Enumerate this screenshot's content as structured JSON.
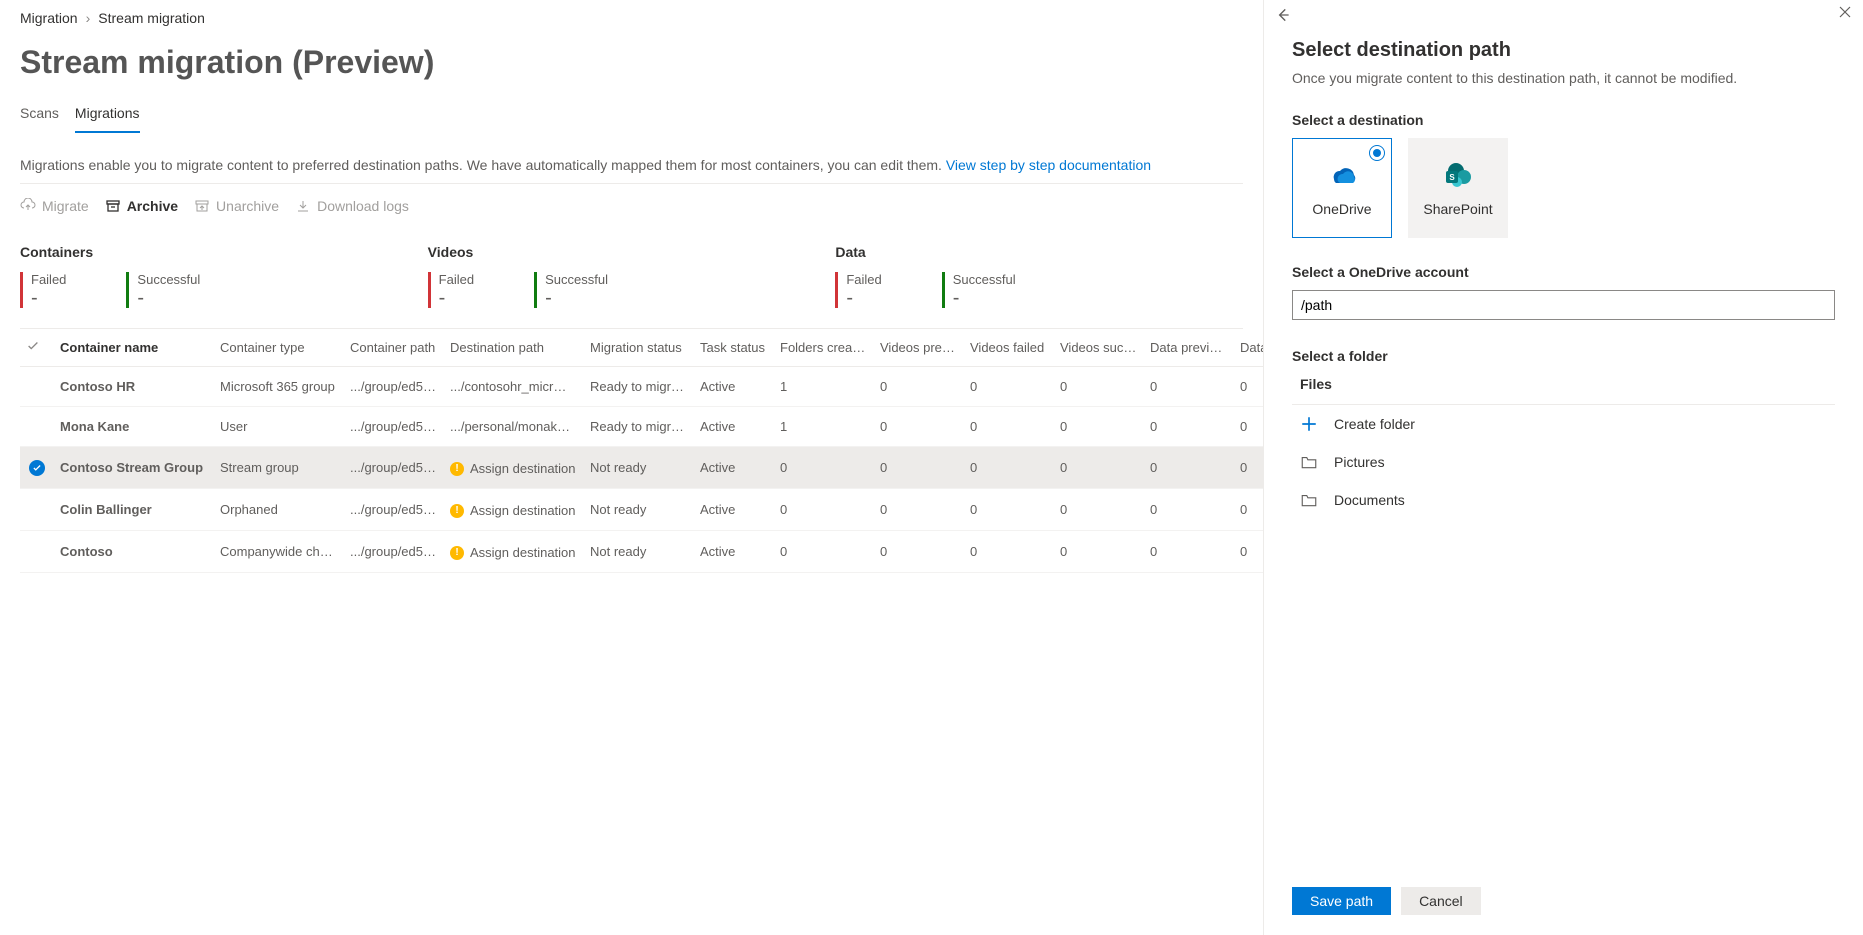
{
  "breadcrumb": {
    "root": "Migration",
    "current": "Stream migration"
  },
  "page_title": "Stream migration (Preview)",
  "tabs": {
    "scans": "Scans",
    "migrations": "Migrations"
  },
  "description": {
    "text": "Migrations enable you to migrate content to preferred destination paths. We have automatically mapped them for most containers, you can edit them. ",
    "link": "View step by step documentation"
  },
  "toolbar": {
    "migrate": "Migrate",
    "archive": "Archive",
    "unarchive": "Unarchive",
    "download_logs": "Download logs"
  },
  "stats": {
    "containers": {
      "heading": "Containers",
      "failed_label": "Failed",
      "failed_value": "-",
      "success_label": "Successful",
      "success_value": "-"
    },
    "videos": {
      "heading": "Videos",
      "failed_label": "Failed",
      "failed_value": "-",
      "success_label": "Successful",
      "success_value": "-"
    },
    "data": {
      "heading": "Data",
      "failed_label": "Failed",
      "failed_value": "-",
      "success_label": "Successful",
      "success_value": "-"
    }
  },
  "columns": {
    "name": "Container name",
    "type": "Container type",
    "cpath": "Container path",
    "dpath": "Destination path",
    "mstatus": "Migration status",
    "tstatus": "Task status",
    "folders": "Folders created",
    "vprev": "Videos prev…",
    "vfail": "Videos failed",
    "vsucc": "Videos succ…",
    "dprev": "Data previo…",
    "dfail": "Data failed"
  },
  "rows": [
    {
      "name": "Contoso HR",
      "type": "Microsoft 365 group",
      "cpath": ".../group/ed53…",
      "dpath": ".../contosohr_micr…",
      "mstatus": "Ready to migrate",
      "tstatus": "Active",
      "folders": "1",
      "vprev": "0",
      "vfail": "0",
      "vsucc": "0",
      "dprev": "0",
      "dfail": "0",
      "warn": false,
      "selected": false
    },
    {
      "name": "Mona Kane",
      "type": "User",
      "cpath": ".../group/ed53…",
      "dpath": ".../personal/monak…",
      "mstatus": "Ready to migrate",
      "tstatus": "Active",
      "folders": "1",
      "vprev": "0",
      "vfail": "0",
      "vsucc": "0",
      "dprev": "0",
      "dfail": "0",
      "warn": false,
      "selected": false
    },
    {
      "name": "Contoso Stream Group",
      "type": "Stream group",
      "cpath": ".../group/ed53…",
      "dpath": "Assign destination",
      "mstatus": "Not ready",
      "tstatus": "Active",
      "folders": "0",
      "vprev": "0",
      "vfail": "0",
      "vsucc": "0",
      "dprev": "0",
      "dfail": "0",
      "warn": true,
      "selected": true
    },
    {
      "name": "Colin Ballinger",
      "type": "Orphaned",
      "cpath": ".../group/ed53…",
      "dpath": "Assign destination",
      "mstatus": "Not ready",
      "tstatus": "Active",
      "folders": "0",
      "vprev": "0",
      "vfail": "0",
      "vsucc": "0",
      "dprev": "0",
      "dfail": "0",
      "warn": true,
      "selected": false
    },
    {
      "name": "Contoso",
      "type": "Companywide channel",
      "cpath": ".../group/ed53…",
      "dpath": "Assign destination",
      "mstatus": "Not ready",
      "tstatus": "Active",
      "folders": "0",
      "vprev": "0",
      "vfail": "0",
      "vsucc": "0",
      "dprev": "0",
      "dfail": "0",
      "warn": true,
      "selected": false
    }
  ],
  "panel": {
    "title": "Select destination path",
    "subtitle": "Once you migrate content to this destination path, it cannot be modified.",
    "dest_label": "Select a destination",
    "onedrive": "OneDrive",
    "sharepoint": "SharePoint",
    "account_label": "Select a OneDrive account",
    "path_value": "/path",
    "folder_label": "Select a folder",
    "files_head": "Files",
    "create_folder": "Create folder",
    "pictures": "Pictures",
    "documents": "Documents",
    "save": "Save path",
    "cancel": "Cancel"
  }
}
